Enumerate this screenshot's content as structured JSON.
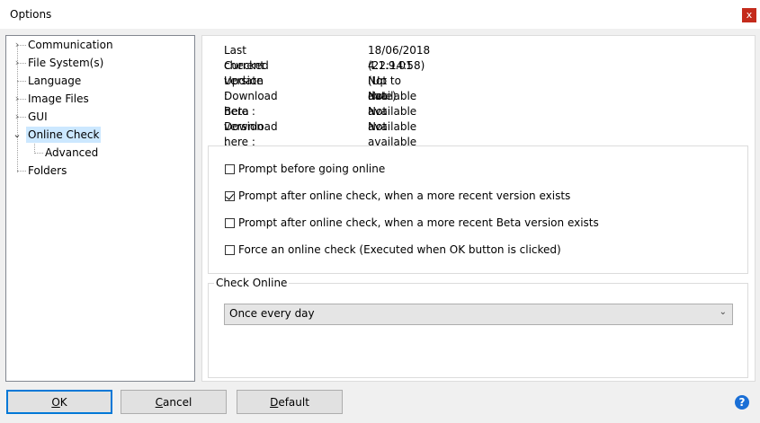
{
  "window": {
    "title": "Options",
    "close_glyph": "x"
  },
  "tree": {
    "items": [
      {
        "label": "Communication",
        "expander": "›",
        "selected": false
      },
      {
        "label": "File System(s)",
        "expander": "›",
        "selected": false
      },
      {
        "label": "Language",
        "expander": "",
        "selected": false
      },
      {
        "label": "Image Files",
        "expander": "›",
        "selected": false
      },
      {
        "label": "GUI",
        "expander": "›",
        "selected": false
      },
      {
        "label": "Online Check",
        "expander": "⌄",
        "selected": true
      },
      {
        "label": "Advanced",
        "expander": "",
        "selected": false
      },
      {
        "label": "Folders",
        "expander": "",
        "selected": false
      }
    ]
  },
  "info": {
    "rows": [
      {
        "label": "Last checked :",
        "value": "18/06/2018 (22:14:58)"
      },
      {
        "label": "Current version :",
        "value": "4.1.9.01 (Up to date)"
      },
      {
        "label": "Update :",
        "value": "Not available"
      },
      {
        "label": "Download here :",
        "value": "Not available"
      },
      {
        "label": "Beta version :",
        "value": "Not available"
      },
      {
        "label": "Download here :",
        "value": "Not available"
      }
    ]
  },
  "options": {
    "checkboxes": [
      {
        "label": "Prompt before going online",
        "checked": false
      },
      {
        "label": "Prompt after online check, when a more recent version exists",
        "checked": true
      },
      {
        "label": "Prompt after online check, when a more recent Beta version exists",
        "checked": false
      },
      {
        "label": "Force an online check (Executed when OK button is clicked)",
        "checked": false
      }
    ]
  },
  "check_online": {
    "legend": "Check Online",
    "selected": "Once every day"
  },
  "buttons": {
    "ok": {
      "accel": "O",
      "rest": "K"
    },
    "cancel": {
      "accel": "C",
      "rest": "ancel"
    },
    "default": {
      "accel": "D",
      "rest": "efault"
    }
  },
  "help_glyph": "?",
  "colors": {
    "selection": "#cce8ff",
    "close": "#c42b1c",
    "focus": "#0078d7",
    "help": "#1a6fd6"
  }
}
